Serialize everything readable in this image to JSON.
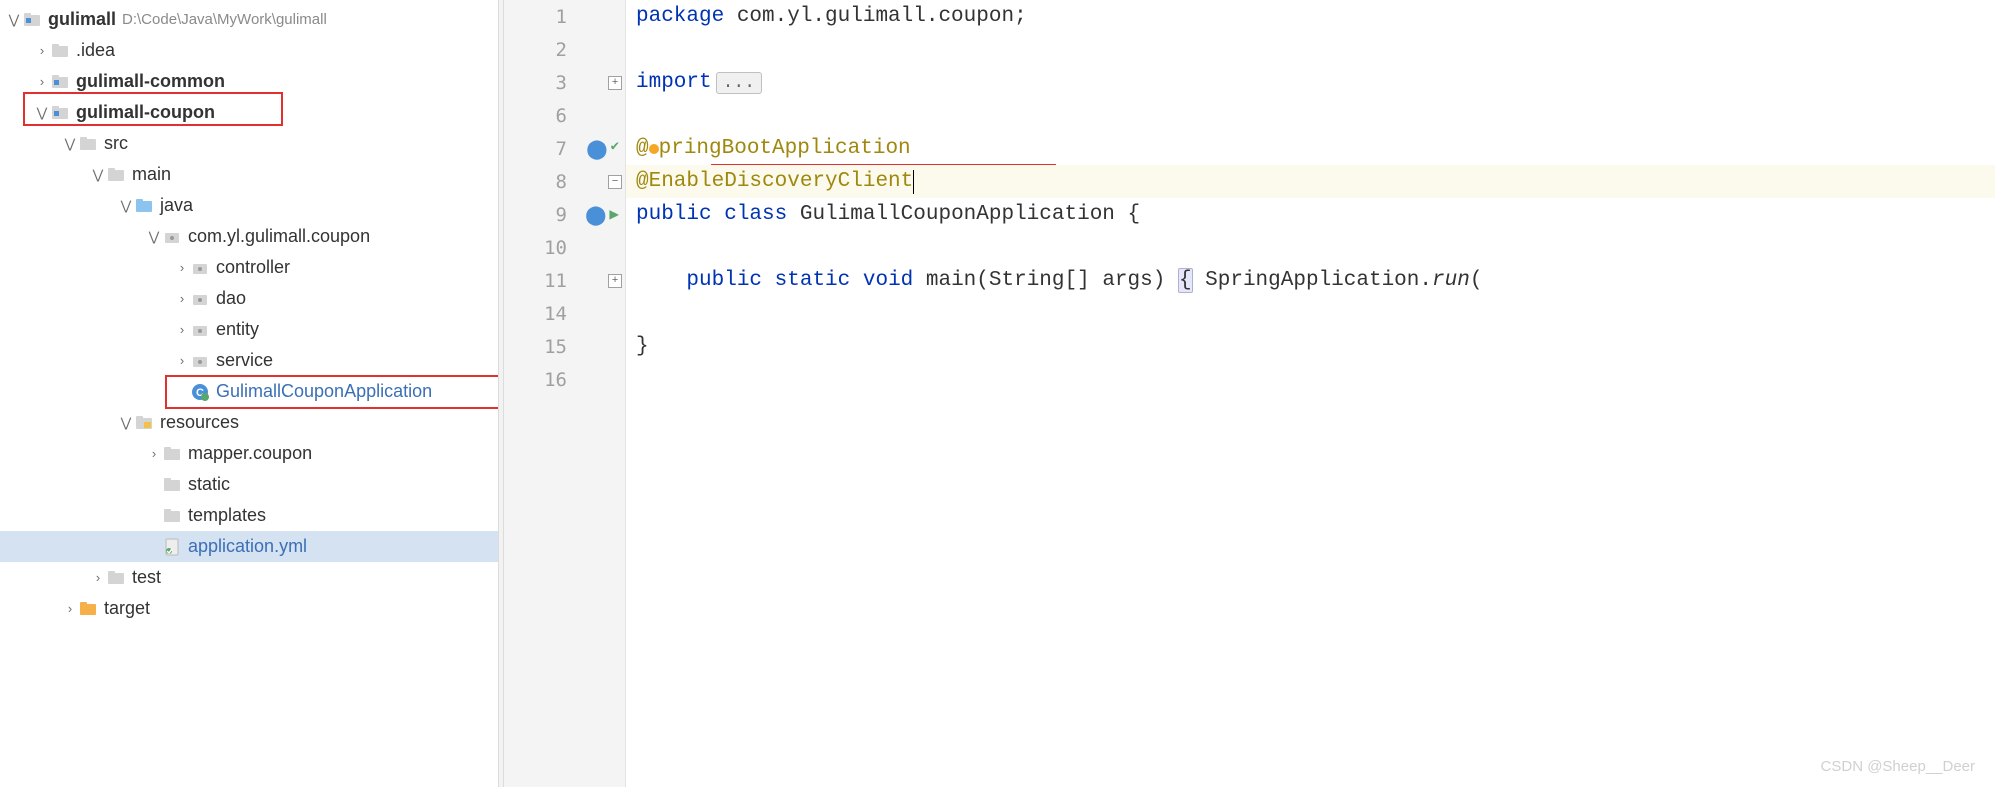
{
  "sidebar": {
    "root": {
      "name": "gulimall",
      "path": "D:\\Code\\Java\\MyWork\\gulimall"
    },
    "items": [
      {
        "name": ".idea",
        "indent": 1,
        "chev": "right",
        "type": "folder"
      },
      {
        "name": "gulimall-common",
        "indent": 1,
        "chev": "right",
        "type": "module",
        "bold": true
      },
      {
        "name": "gulimall-coupon",
        "indent": 1,
        "chev": "down",
        "type": "module",
        "bold": true
      },
      {
        "name": "src",
        "indent": 2,
        "chev": "down",
        "type": "folder"
      },
      {
        "name": "main",
        "indent": 3,
        "chev": "down",
        "type": "folder"
      },
      {
        "name": "java",
        "indent": 4,
        "chev": "down",
        "type": "srcfolder"
      },
      {
        "name": "com.yl.gulimall.coupon",
        "indent": 5,
        "chev": "down",
        "type": "pkg"
      },
      {
        "name": "controller",
        "indent": 6,
        "chev": "right",
        "type": "pkg"
      },
      {
        "name": "dao",
        "indent": 6,
        "chev": "right",
        "type": "pkg"
      },
      {
        "name": "entity",
        "indent": 6,
        "chev": "right",
        "type": "pkg"
      },
      {
        "name": "service",
        "indent": 6,
        "chev": "right",
        "type": "pkg"
      },
      {
        "name": "GulimallCouponApplication",
        "indent": 6,
        "chev": "",
        "type": "class",
        "blue": true
      },
      {
        "name": "resources",
        "indent": 4,
        "chev": "down",
        "type": "resfolder"
      },
      {
        "name": "mapper.coupon",
        "indent": 5,
        "chev": "right",
        "type": "folder"
      },
      {
        "name": "static",
        "indent": 5,
        "chev": "",
        "type": "folder"
      },
      {
        "name": "templates",
        "indent": 5,
        "chev": "",
        "type": "folder"
      },
      {
        "name": "application.yml",
        "indent": 5,
        "chev": "",
        "type": "yml",
        "blue": true,
        "selected": true
      },
      {
        "name": "test",
        "indent": 3,
        "chev": "right",
        "type": "folder"
      },
      {
        "name": "target",
        "indent": 2,
        "chev": "right",
        "type": "target"
      }
    ]
  },
  "editor": {
    "lines": [
      {
        "n": "1",
        "tokens": [
          [
            "kw",
            "package"
          ],
          [
            "pkg",
            " com.yl.gulimall.coupon;"
          ]
        ]
      },
      {
        "n": "2",
        "tokens": []
      },
      {
        "n": "3",
        "tokens": [
          [
            "kw",
            "import"
          ]
        ],
        "folded": "...",
        "foldplus": true
      },
      {
        "n": "6",
        "tokens": []
      },
      {
        "n": "7",
        "tokens": [
          [
            "ann",
            "@"
          ],
          [
            "orange",
            ""
          ],
          [
            "ann",
            "pringBootApplication"
          ]
        ],
        "marks": [
          "leaf",
          "check"
        ]
      },
      {
        "n": "8",
        "tokens": [
          [
            "ann",
            "@EnableDiscoveryClient"
          ]
        ],
        "cursor": true,
        "cursorline": true,
        "foldminus": true
      },
      {
        "n": "9",
        "tokens": [
          [
            "kw",
            "public "
          ],
          [
            "kw",
            "class "
          ],
          [
            "typ",
            "GulimallCouponApplication "
          ],
          [
            "str",
            "{"
          ]
        ],
        "marks": [
          "leaf",
          "run"
        ]
      },
      {
        "n": "10",
        "tokens": []
      },
      {
        "n": "11",
        "tokens": [
          [
            "str",
            "    "
          ],
          [
            "kw",
            "public "
          ],
          [
            "kw",
            "static "
          ],
          [
            "kw",
            "void "
          ],
          [
            "typ",
            "main"
          ],
          [
            "str",
            "(String[] args)"
          ],
          [
            "str",
            " "
          ],
          [
            "bracket",
            "{"
          ],
          [
            "str",
            " SpringApplication."
          ],
          [
            "mtd",
            "run"
          ],
          [
            "str",
            "("
          ]
        ],
        "marks": [
          "run"
        ],
        "foldplus": true
      },
      {
        "n": "14",
        "tokens": []
      },
      {
        "n": "15",
        "tokens": [
          [
            "str",
            "}"
          ]
        ]
      },
      {
        "n": "16",
        "tokens": []
      }
    ]
  },
  "watermark": "CSDN @Sheep__Deer"
}
